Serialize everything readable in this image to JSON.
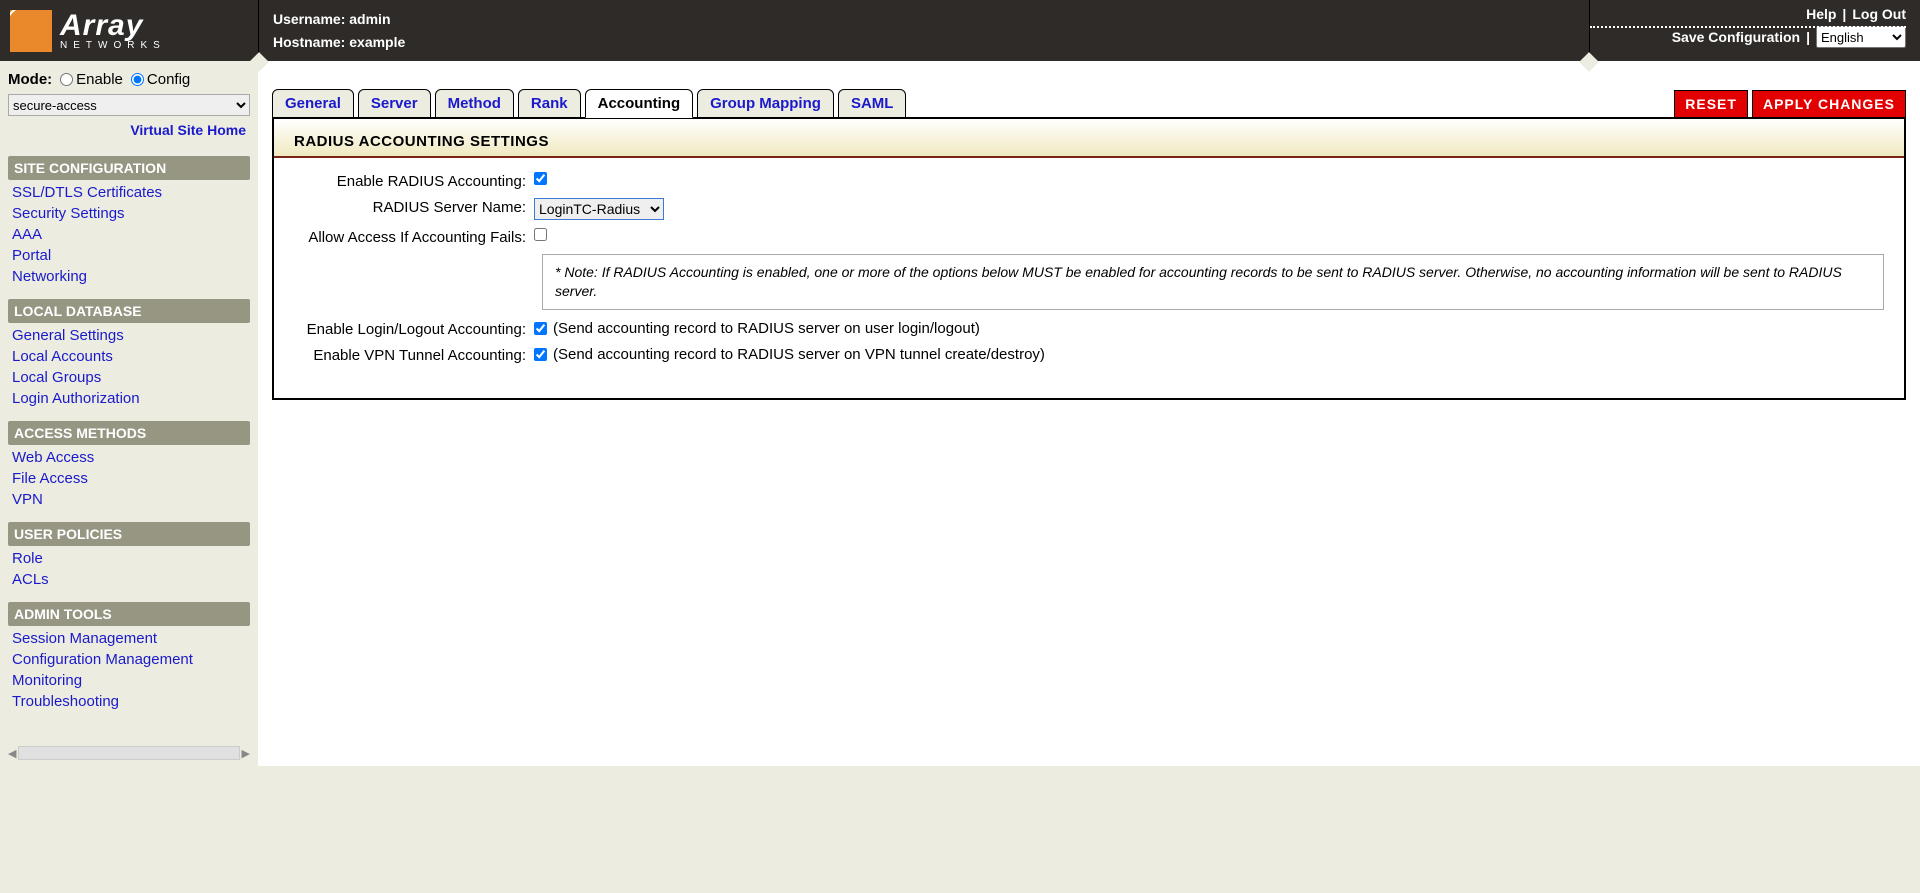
{
  "header": {
    "brand_big": "Array",
    "brand_small": "NETWORKS",
    "username_label": "Username:",
    "username_value": "admin",
    "hostname_label": "Hostname:",
    "hostname_value": "example",
    "help": "Help",
    "logout": "Log Out",
    "save_config": "Save Configuration",
    "language": "English"
  },
  "mode": {
    "label": "Mode:",
    "enable": "Enable",
    "config": "Config",
    "selected": "config",
    "dropdown_value": "secure-access"
  },
  "home_link": "Virtual Site Home",
  "sidebar": [
    {
      "title": "SITE CONFIGURATION",
      "items": [
        "SSL/DTLS Certificates",
        "Security Settings",
        "AAA",
        "Portal",
        "Networking"
      ]
    },
    {
      "title": "LOCAL DATABASE",
      "items": [
        "General Settings",
        "Local Accounts",
        "Local Groups",
        "Login Authorization"
      ]
    },
    {
      "title": "ACCESS METHODS",
      "items": [
        "Web Access",
        "File Access",
        "VPN"
      ]
    },
    {
      "title": "USER POLICIES",
      "items": [
        "Role",
        "ACLs"
      ]
    },
    {
      "title": "ADMIN TOOLS",
      "items": [
        "Session Management",
        "Configuration Management",
        "Monitoring",
        "Troubleshooting"
      ]
    }
  ],
  "tabs": [
    "General",
    "Server",
    "Method",
    "Rank",
    "Accounting",
    "Group Mapping",
    "SAML"
  ],
  "active_tab": "Accounting",
  "buttons": {
    "reset": "RESET",
    "apply": "APPLY  CHANGES"
  },
  "panel": {
    "title": "RADIUS ACCOUNTING SETTINGS",
    "rows": {
      "enable_accounting": {
        "label": "Enable RADIUS Accounting:",
        "checked": true
      },
      "server_name": {
        "label": "RADIUS Server Name:",
        "value": "LoginTC-Radius"
      },
      "allow_fail": {
        "label": "Allow Access If Accounting Fails:",
        "checked": false
      },
      "note": "* Note: If RADIUS Accounting is enabled, one or more of the options below MUST be enabled for accounting records to be sent to RADIUS server.  Otherwise, no accounting information will be sent to RADIUS server.",
      "login_logout": {
        "label": "Enable Login/Logout Accounting:",
        "checked": true,
        "hint": "(Send accounting record to RADIUS server on user login/logout)"
      },
      "vpn_tunnel": {
        "label": "Enable VPN Tunnel Accounting:",
        "checked": true,
        "hint": "(Send accounting record to RADIUS server on VPN tunnel create/destroy)"
      }
    }
  }
}
